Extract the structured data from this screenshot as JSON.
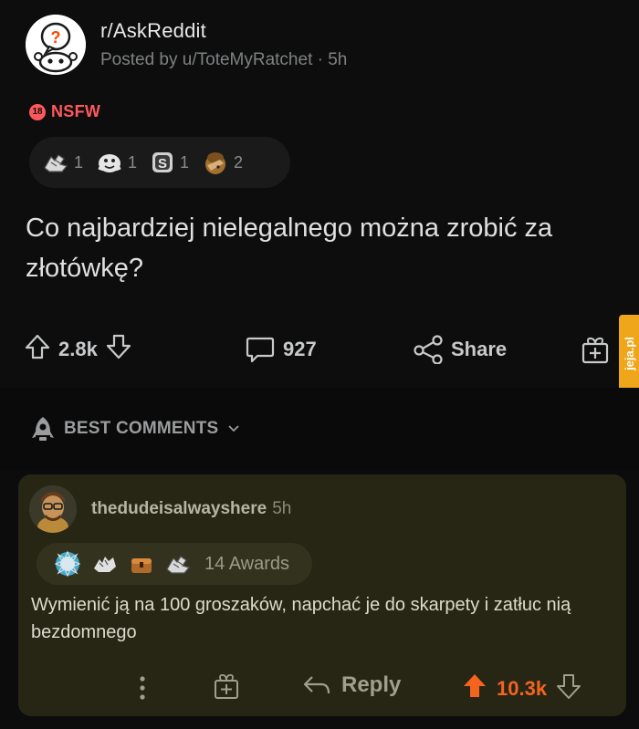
{
  "post": {
    "subreddit": "r/AskReddit",
    "posted_by": "Posted by u/ToteMyRatchet · 5h",
    "nsfw_label": "NSFW",
    "nsfw_badge": "18",
    "awards": [
      {
        "icon": "helpful-hands-award-icon",
        "count": "1"
      },
      {
        "icon": "wholesome-seal-award-icon",
        "count": "1"
      },
      {
        "icon": "silver-award-icon",
        "count": "1"
      },
      {
        "icon": "facepalm-award-icon",
        "count": "2"
      }
    ],
    "title": "Co najbardziej nielegalnego można zrobić za złotówkę?",
    "upvotes": "2.8k",
    "comments": "927",
    "share_label": "Share"
  },
  "watermark": "jeja.pl",
  "sort": {
    "label": "BEST COMMENTS"
  },
  "comment": {
    "username": "thedudeisalwayshere",
    "time": "5h",
    "awards_label": "14 Awards",
    "body": "Wymienić ją na 100 groszaków, napchać je do skarpety i zatłuc nią bezdomnego",
    "reply_label": "Reply",
    "score": "10.3k"
  },
  "colors": {
    "accent_upvote": "#f4641e",
    "nsfw": "#ff585b",
    "comment_bg": "#272615",
    "watermark": "#f0a61a"
  }
}
